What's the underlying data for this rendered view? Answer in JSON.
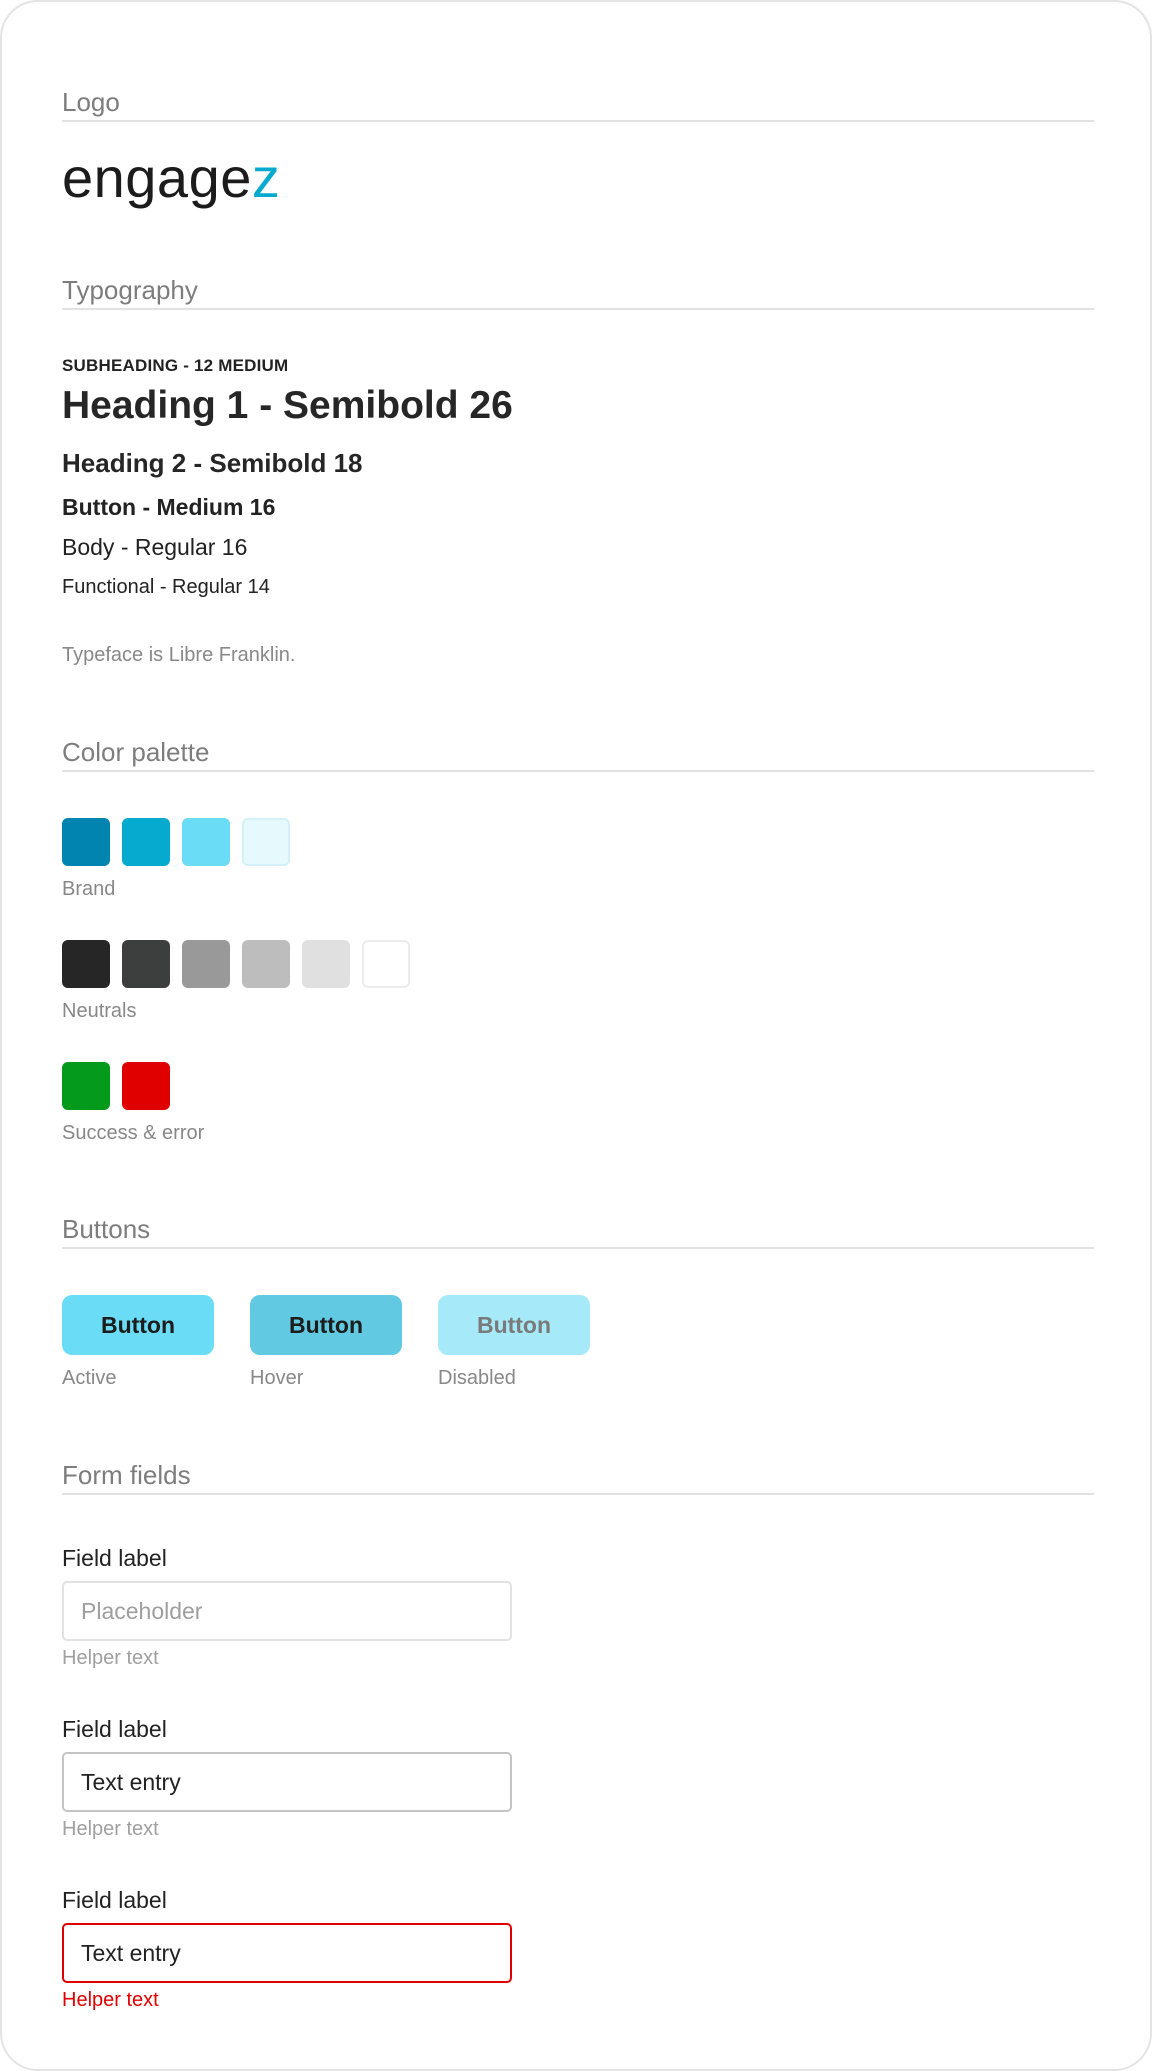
{
  "sections": {
    "logo": {
      "title": "Logo",
      "wordmark_main": "engage",
      "wordmark_accent": "z",
      "accent_color": "#06aacf"
    },
    "typography": {
      "title": "Typography",
      "samples": {
        "subheading": "SUBHEADING - 12 MEDIUM",
        "heading1": "Heading 1 - Semibold 26",
        "heading2": "Heading 2 - Semibold 18",
        "button": "Button - Medium 16",
        "body": "Body - Regular 16",
        "functional": "Functional - Regular 14"
      },
      "note": "Typeface is Libre Franklin."
    },
    "color_palette": {
      "title": "Color palette",
      "groups": [
        {
          "label": "Brand",
          "colors": [
            "#0284b0",
            "#06aacf",
            "#6adcf5",
            "#e6f9fd"
          ]
        },
        {
          "label": "Neutrals",
          "colors": [
            "#262626",
            "#3d3f3f",
            "#999999",
            "#bdbdbd",
            "#e0e0e0",
            "#ffffff"
          ]
        },
        {
          "label": "Success & error",
          "colors": [
            "#049a1b",
            "#e10000"
          ]
        }
      ]
    },
    "buttons": {
      "title": "Buttons",
      "items": [
        {
          "label": "Button",
          "caption": "Active",
          "bg": "#6adcf5",
          "fg": "#1c1c1c"
        },
        {
          "label": "Button",
          "caption": "Hover",
          "bg": "#61c9e1",
          "fg": "#1c1c1c"
        },
        {
          "label": "Button",
          "caption": "Disabled",
          "bg": "#a6eaf9",
          "fg": "#7a7a7a"
        }
      ]
    },
    "form_fields": {
      "title": "Form fields",
      "fields": [
        {
          "label": "Field label",
          "value": "",
          "placeholder": "Placeholder",
          "helper": "Helper text",
          "state": "empty"
        },
        {
          "label": "Field label",
          "value": "Text entry",
          "placeholder": "",
          "helper": "Helper text",
          "state": "filled"
        },
        {
          "label": "Field label",
          "value": "Text entry",
          "placeholder": "",
          "helper": "Helper text",
          "state": "error"
        }
      ]
    }
  }
}
